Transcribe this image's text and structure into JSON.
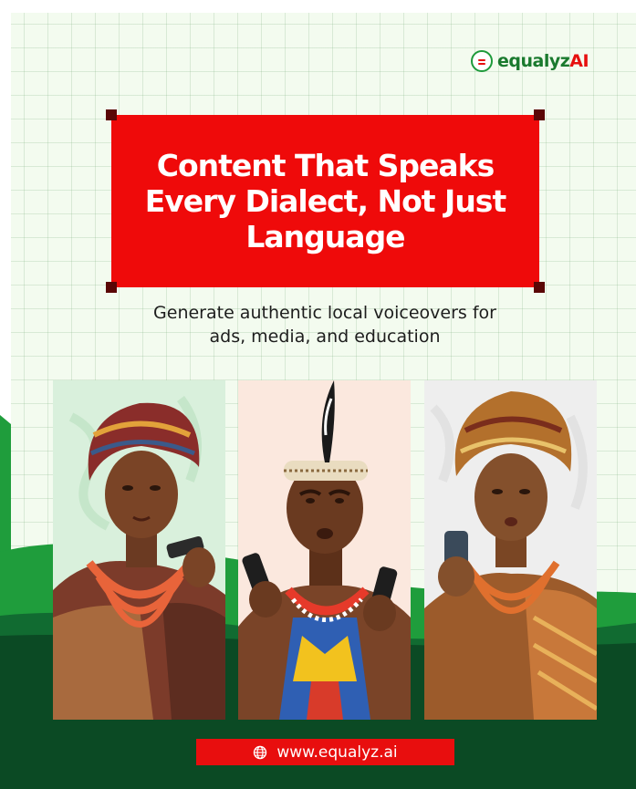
{
  "brand": {
    "logo_prefix": "equalyz",
    "logo_suffix": "AI",
    "icon": "equals-circle-icon"
  },
  "headline": {
    "line1": "Content That Speaks",
    "line2": "Every Dialect, Not Just",
    "line3": "Language"
  },
  "subtitle": {
    "line1": "Generate authentic local voiceovers for",
    "line2": "ads, media, and education"
  },
  "panels": [
    {
      "subject": "woman-in-gele-with-phone"
    },
    {
      "subject": "man-in-headdress-with-phone"
    },
    {
      "subject": "woman-in-gele-with-phone"
    }
  ],
  "footer": {
    "url": "www.equalyz.ai",
    "icon": "globe-icon"
  },
  "colors": {
    "accent_red": "#ef0a0a",
    "brand_green": "#1a7a2e",
    "dark_green": "#0b4a24",
    "background": "#f3fbef"
  }
}
